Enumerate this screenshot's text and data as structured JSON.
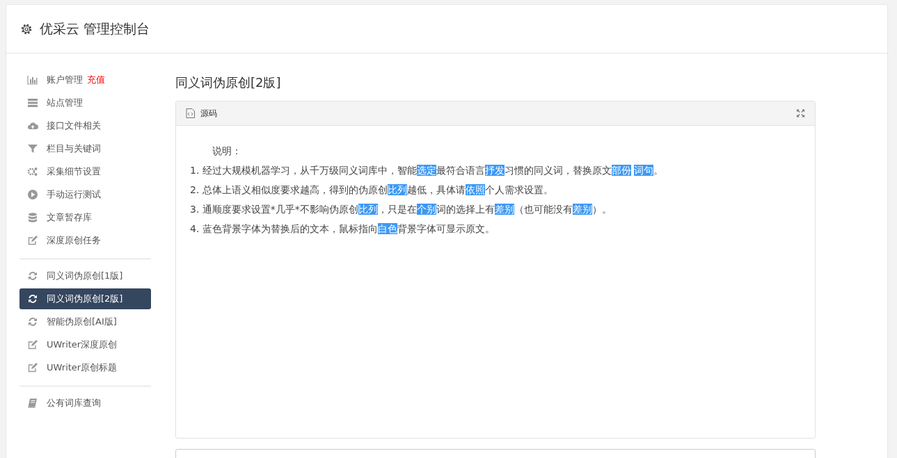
{
  "header": {
    "title": "优采云 管理控制台"
  },
  "sidebar": {
    "groups": [
      {
        "items": [
          {
            "kind": "chart",
            "label": "账户管理",
            "badge": "充值",
            "selected": false
          },
          {
            "kind": "server",
            "label": "站点管理",
            "selected": false
          },
          {
            "kind": "cloud",
            "label": "接口文件相关",
            "selected": false
          },
          {
            "kind": "filter",
            "label": "栏目与关键词",
            "selected": false
          },
          {
            "kind": "gears",
            "label": "采集细节设置",
            "selected": false
          },
          {
            "kind": "play",
            "label": "手动运行测试",
            "selected": false
          },
          {
            "kind": "database",
            "label": "文章暂存库",
            "selected": false
          },
          {
            "kind": "edit",
            "label": "深度原创任务",
            "selected": false
          }
        ]
      },
      {
        "items": [
          {
            "kind": "refresh",
            "label": "同义词伪原创[1版]",
            "selected": false
          },
          {
            "kind": "refresh",
            "label": "同义词伪原创[2版]",
            "selected": true
          },
          {
            "kind": "refresh",
            "label": "智能伪原创[AI版]",
            "selected": false
          },
          {
            "kind": "edit",
            "label": "UWriter深度原创",
            "selected": false
          },
          {
            "kind": "edit",
            "label": "UWriter原创标题",
            "selected": false
          }
        ]
      },
      {
        "items": [
          {
            "kind": "book",
            "label": "公有词库查询",
            "selected": false
          }
        ]
      }
    ]
  },
  "content": {
    "title": "同义词伪原创[2版]",
    "panel": {
      "title": "源码",
      "intro": "说明：",
      "lines": [
        [
          {
            "text": "1. 经过大规模机器学习，从千万级同义词库中，智能",
            "replaced": false
          },
          {
            "text": "选定",
            "replaced": true
          },
          {
            "text": "最符合语言",
            "replaced": false
          },
          {
            "text": "抒发",
            "replaced": true
          },
          {
            "text": "习惯的同义词，替换原文",
            "replaced": false
          },
          {
            "text": "部份",
            "replaced": true
          },
          {
            "text": "词句",
            "replaced": true
          },
          {
            "text": "。",
            "replaced": false
          }
        ],
        [
          {
            "text": "2. 总体上语义相似度要求越高，得到的伪原创",
            "replaced": false
          },
          {
            "text": "比列",
            "replaced": true
          },
          {
            "text": "越低，具体请",
            "replaced": false
          },
          {
            "text": "依照",
            "replaced": true
          },
          {
            "text": "个人需求设置。",
            "replaced": false
          }
        ],
        [
          {
            "text": "3. 通顺度要求设置*几乎*不影响伪原创",
            "replaced": false
          },
          {
            "text": "比列",
            "replaced": true
          },
          {
            "text": "，只是在",
            "replaced": false
          },
          {
            "text": "个别",
            "replaced": true
          },
          {
            "text": "词的选择上有",
            "replaced": false
          },
          {
            "text": "差别",
            "replaced": true
          },
          {
            "text": "（也可能没有",
            "replaced": false
          },
          {
            "text": "差别",
            "replaced": true
          },
          {
            "text": "）。",
            "replaced": false
          }
        ],
        [
          {
            "text": "4. 蓝色背景字体为替换后的文本，鼠标指向",
            "replaced": false
          },
          {
            "text": "白色",
            "replaced": true
          },
          {
            "text": "背景字体可显示原文。",
            "replaced": false
          }
        ]
      ]
    }
  }
}
